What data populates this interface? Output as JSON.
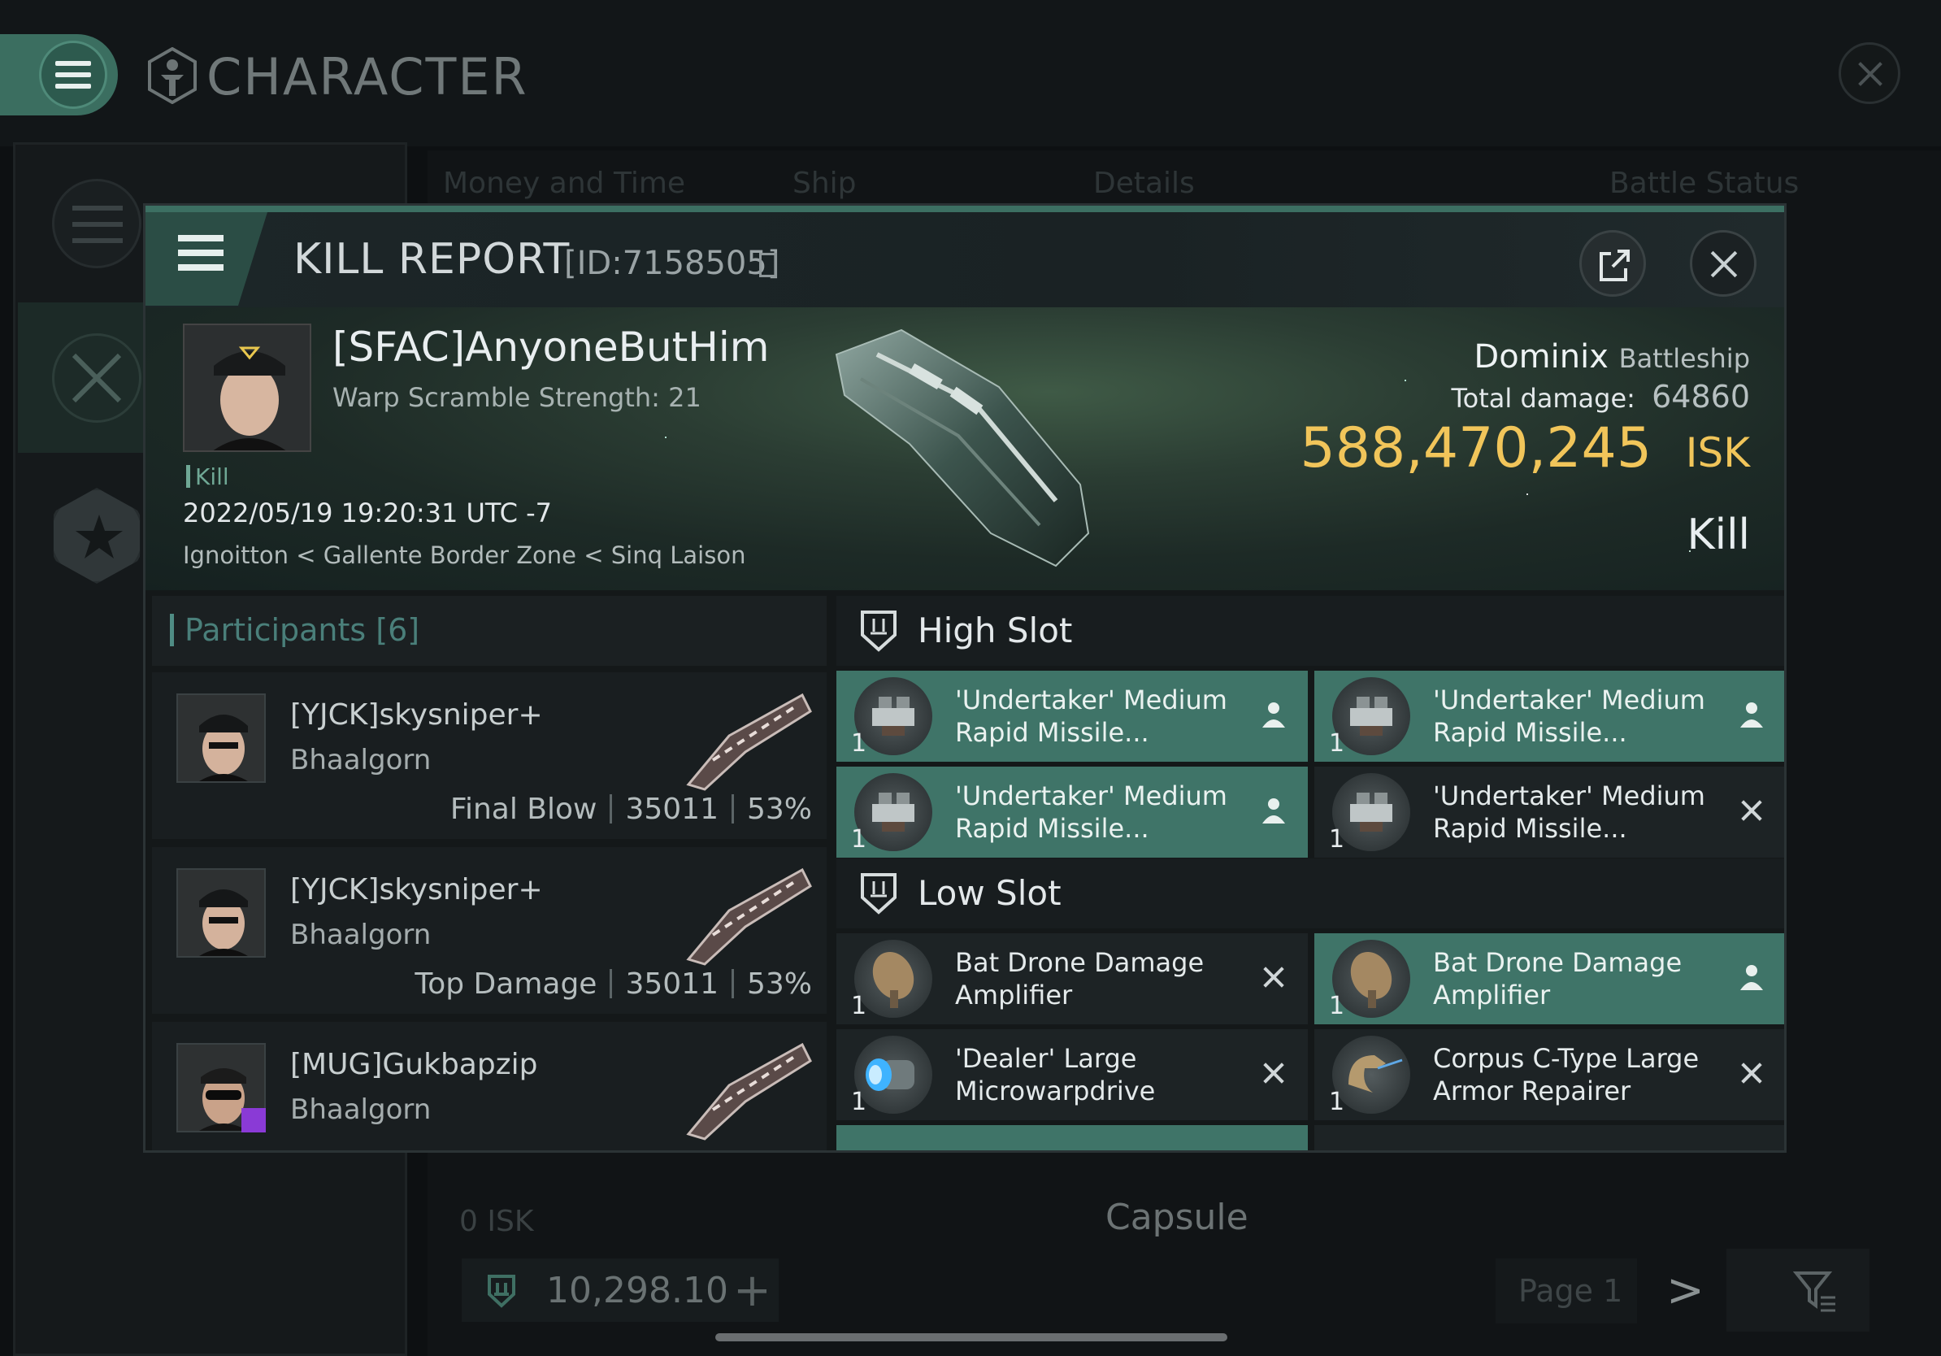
{
  "app": {
    "title": "CHARACTER",
    "bg_tabs": [
      "Money and Time",
      "Ship",
      "Details",
      "Battle Status"
    ],
    "bg_isk": "0 ISK",
    "bg_ship": "Capsule",
    "balance": "10,298.10",
    "plus": "+",
    "page": "Page 1",
    "next": ">"
  },
  "report": {
    "title": "KILL REPORT",
    "id": "[ID:7158505]",
    "victim": {
      "name": "[SFAC]AnyoneButHim",
      "sub": "Warp Scramble Strength: 21",
      "tag": "Kill",
      "date": "2022/05/19 19:20:31 UTC -7",
      "location": "Ignoitton < Gallente Border Zone < Sinq Laison"
    },
    "ship": {
      "name": "Dominix",
      "class": "Battleship",
      "total_damage_label": "Total damage:",
      "total_damage": "64860",
      "isk_value": "588,470,245",
      "isk_unit": "ISK",
      "result": "Kill"
    },
    "participants_title": "Participants [6]",
    "participants": [
      {
        "name": "[YJCK]skysniper+",
        "ship": "Bhaalgorn",
        "label": "Final Blow",
        "damage": "35011",
        "percent": "53%"
      },
      {
        "name": "[YJCK]skysniper+",
        "ship": "Bhaalgorn",
        "label": "Top Damage",
        "damage": "35011",
        "percent": "53%"
      },
      {
        "name": "[MUG]Gukbapzip",
        "ship": "Bhaalgorn",
        "label": "",
        "damage": "",
        "percent": ""
      }
    ],
    "high_slot": {
      "title": "High Slot",
      "modules": [
        {
          "name": "'Undertaker' Medium Rapid Missile...",
          "qty": "1",
          "status": "fitted"
        },
        {
          "name": "'Undertaker' Medium Rapid Missile...",
          "qty": "1",
          "status": "fitted"
        },
        {
          "name": "'Undertaker' Medium Rapid Missile...",
          "qty": "1",
          "status": "fitted"
        },
        {
          "name": "'Undertaker' Medium Rapid Missile...",
          "qty": "1",
          "status": "destroyed"
        }
      ]
    },
    "low_slot": {
      "title": "Low Slot",
      "modules": [
        {
          "name": "Bat Drone Damage Amplifier",
          "qty": "1",
          "status": "destroyed"
        },
        {
          "name": "Bat Drone Damage Amplifier",
          "qty": "1",
          "status": "fitted"
        },
        {
          "name": "'Dealer' Large Microwarpdrive",
          "qty": "1",
          "status": "destroyed"
        },
        {
          "name": "Corpus C-Type Large Armor Repairer",
          "qty": "1",
          "status": "destroyed"
        }
      ]
    }
  }
}
